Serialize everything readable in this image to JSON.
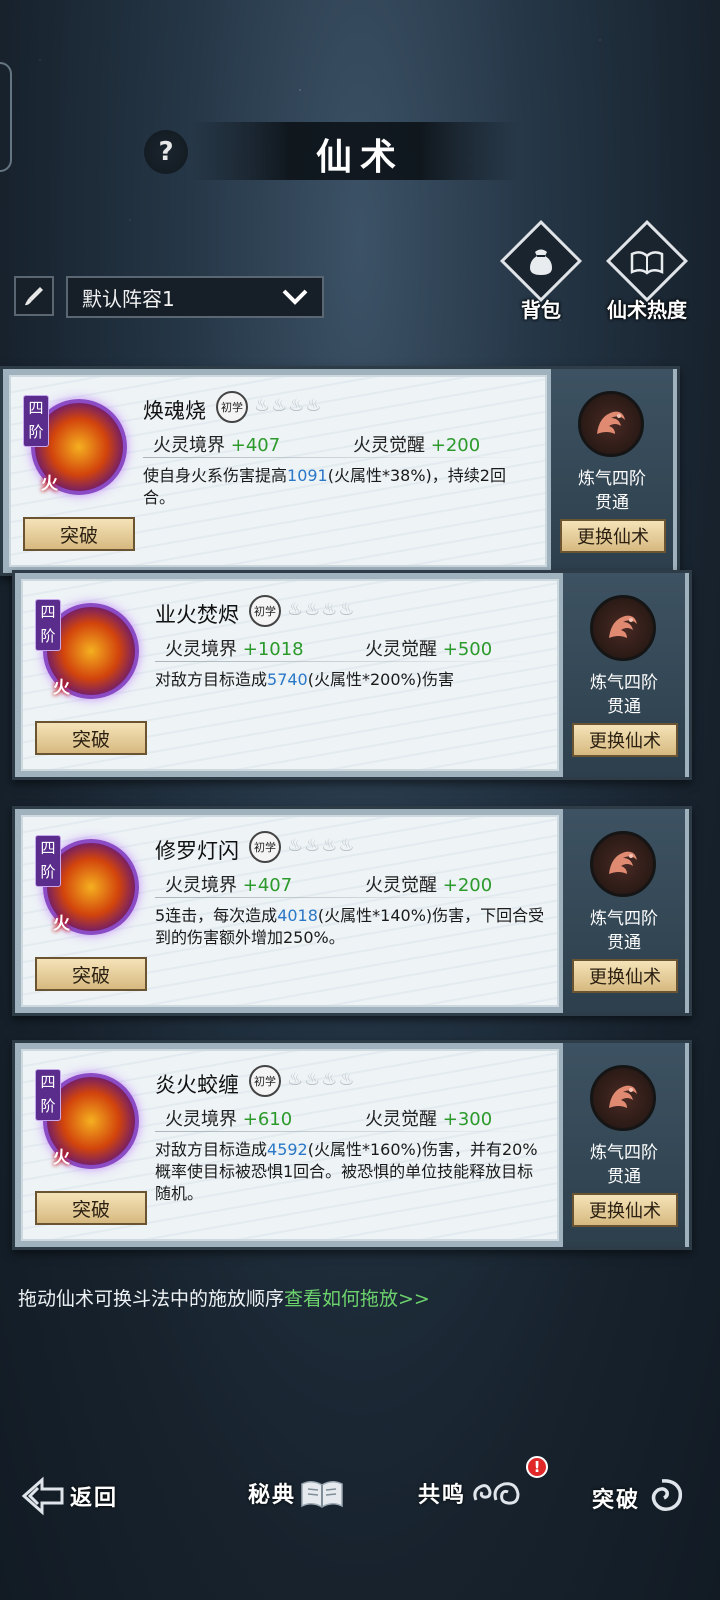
{
  "header": {
    "help_label": "?",
    "title": "仙术"
  },
  "lineup": {
    "selected": "默认阵容1"
  },
  "top_actions": [
    {
      "label": "背包",
      "icon": "bag-icon"
    },
    {
      "label": "仙术热度",
      "icon": "book-icon"
    }
  ],
  "cards": [
    {
      "tier": "四阶",
      "element": "火",
      "name": "焕魂烧",
      "level_badge": "初学",
      "stat1_label": "火灵境界",
      "stat1_value": "+407",
      "stat2_label": "火灵觉醒",
      "stat2_value": "+200",
      "desc_pre": "使自身火系伤害提高",
      "desc_num": "1091",
      "desc_post": "(火属性*38%)，持续2回合。",
      "break_label": "突破",
      "cult_line1": "炼气四阶",
      "cult_line2": "贯通",
      "swap_label": "更换仙术"
    },
    {
      "tier": "四阶",
      "element": "火",
      "name": "业火焚烬",
      "level_badge": "初学",
      "stat1_label": "火灵境界",
      "stat1_value": "+1018",
      "stat2_label": "火灵觉醒",
      "stat2_value": "+500",
      "desc_pre": "对敌方目标造成",
      "desc_num": "5740",
      "desc_post": "(火属性*200%)伤害",
      "break_label": "突破",
      "cult_line1": "炼气四阶",
      "cult_line2": "贯通",
      "swap_label": "更换仙术"
    },
    {
      "tier": "四阶",
      "element": "火",
      "name": "修罗灯闪",
      "level_badge": "初学",
      "stat1_label": "火灵境界",
      "stat1_value": "+407",
      "stat2_label": "火灵觉醒",
      "stat2_value": "+200",
      "desc_pre": "5连击，每次造成",
      "desc_num": "4018",
      "desc_post": "(火属性*140%)伤害，下回合受到的伤害额外增加250%。",
      "break_label": "突破",
      "cult_line1": "炼气四阶",
      "cult_line2": "贯通",
      "swap_label": "更换仙术"
    },
    {
      "tier": "四阶",
      "element": "火",
      "name": "炎火蛟缠",
      "level_badge": "初学",
      "stat1_label": "火灵境界",
      "stat1_value": "+610",
      "stat2_label": "火灵觉醒",
      "stat2_value": "+300",
      "desc_pre": "对敌方目标造成",
      "desc_num": "4592",
      "desc_post": "(火属性*160%)伤害，并有20%概率使目标被恐惧1回合。被恐惧的单位技能释放目标随机。",
      "break_label": "突破",
      "cult_line1": "炼气四阶",
      "cult_line2": "贯通",
      "swap_label": "更换仙术"
    }
  ],
  "hint": {
    "text": "拖动仙术可换斗法中的施放顺序",
    "link": "查看如何拖放>>"
  },
  "bottom_nav": {
    "back": "返回",
    "manual": "秘典",
    "resonance": "共鸣",
    "breakthrough": "突破",
    "notice_badge": "!"
  },
  "colors": {
    "plus_green": "#2b9a2b",
    "number_blue": "#2a78c7",
    "link_green": "#6dd36d",
    "tier_purple": "#5a2d8c"
  }
}
